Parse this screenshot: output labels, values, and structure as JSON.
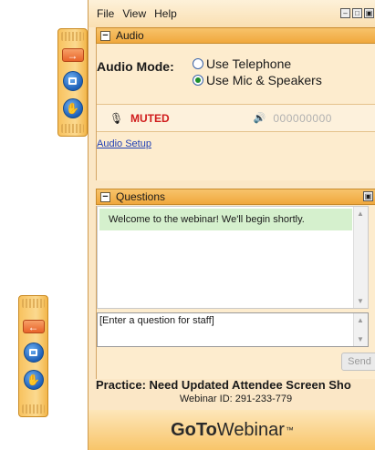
{
  "menu": [
    "File",
    "View",
    "Help"
  ],
  "window_buttons": [
    "–",
    "□",
    "▣"
  ],
  "audio": {
    "header": "Audio",
    "mode_label": "Audio Mode:",
    "options": [
      {
        "label": "Use Telephone",
        "selected": false
      },
      {
        "label": "Use Mic & Speakers",
        "selected": true
      }
    ],
    "mic_state": "MUTED",
    "level_meter": "000000000",
    "setup_link": "Audio Setup"
  },
  "questions": {
    "header": "Questions",
    "welcome_message": "Welcome to the webinar! We'll begin shortly.",
    "input_placeholder": "[Enter a question for staff]",
    "send_label": "Send"
  },
  "footer": {
    "title": "Practice: Need Updated Attendee Screen Sho",
    "webinar_id": "Webinar ID: 291-233-779",
    "brand_bold": "GoTo",
    "brand_rest": "Webinar",
    "brand_tm": "™"
  },
  "icons": {
    "grab_tab_arrow_top": "→",
    "grab_tab_arrow_bottom": "←",
    "mic": "microphone-icon",
    "speaker": "speaker-icon"
  },
  "colors": {
    "muted": "#d01c1c",
    "link": "#1f3fb5",
    "panel_bg": "#fbe7c6",
    "section_header": "#f0a83d",
    "welcome_bg": "#d5f0cd"
  }
}
